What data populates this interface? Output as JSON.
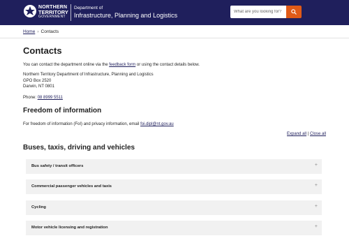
{
  "header": {
    "logo_lines": [
      "NORTHERN",
      "TERRITORY",
      "GOVERNMENT"
    ],
    "dept_small": "Department of",
    "dept_name": "Infrastructure, Planning and Logistics",
    "search_placeholder": "What are you looking for?"
  },
  "breadcrumb": {
    "home": "Home",
    "current": "Contacts"
  },
  "page": {
    "title": "Contacts",
    "intro_before": "You can contact the department online via the ",
    "intro_link": "feedback form",
    "intro_after": " or using the contact details below.",
    "address_lines": [
      "Northern Territory Department of Infrastructure, Planning and Logistics",
      "GPO Box 2520",
      "Darwin, NT 0801"
    ],
    "phone_label": "Phone: ",
    "phone": "08 8999 5511"
  },
  "foi": {
    "heading": "Freedom of information",
    "text_before": "For freedom of information (FoI) and privacy information, email ",
    "email": "foi.dipl@nt.gov.au"
  },
  "controls": {
    "expand_all": "Expand all",
    "separator": " | ",
    "close_all": "Close all"
  },
  "section": {
    "heading": "Buses, taxis, driving and vehicles",
    "items": [
      "Bus safety / transit officers",
      "Commercial passenger vehicles and taxis",
      "Cycling",
      "Motor vehicle licensing and registration"
    ],
    "expand_symbol": "+"
  },
  "colors": {
    "header_bg": "#1f1f5c",
    "search_button": "#e05a17",
    "accordion_bg": "#f1f1f1"
  }
}
